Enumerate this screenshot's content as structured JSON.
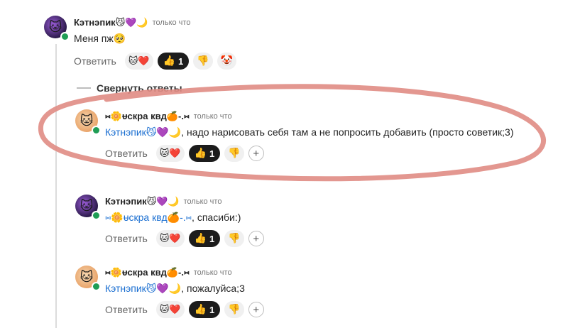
{
  "comments": [
    {
      "author": "Кэтнэпик😼💜🌙",
      "time": "только что",
      "text": "Меня пж🥺",
      "reply_label": "Ответить",
      "reactions": {
        "avatar_emoji": "🐱❤️",
        "like_emoji": "👍",
        "like_count": "1",
        "dislike_emoji": "👎",
        "clown_emoji": "🤡"
      }
    },
    {
      "author": "⑅🌼ᵾскра квд🍊-.⑅",
      "time": "только что",
      "mention": "Кэтнэпик😼💜🌙",
      "text": ", надо нарисовать себя там а не попросить добавить (просто советик;3)",
      "reply_label": "Ответить",
      "reactions": {
        "avatar_emoji": "🐱❤️",
        "like_emoji": "👍",
        "like_count": "1",
        "dislike_emoji": "👎",
        "plus": "+"
      }
    },
    {
      "author": "Кэтнэпик😼💜🌙",
      "time": "только что",
      "mention": "⑅🌼ᵾскра квд🍊-.⑅",
      "text": ", спасиби:)",
      "reply_label": "Ответить",
      "reactions": {
        "avatar_emoji": "🐱❤️",
        "like_emoji": "👍",
        "like_count": "1",
        "dislike_emoji": "👎",
        "plus": "+"
      }
    },
    {
      "author": "⑅🌼ᵾскра квд🍊-.⑅",
      "time": "только что",
      "mention": "Кэтнэпик😼💜🌙",
      "text": ", пожалуйса;3",
      "reply_label": "Ответить",
      "reactions": {
        "avatar_emoji": "🐱❤️",
        "like_emoji": "👍",
        "like_count": "1",
        "dislike_emoji": "👎",
        "plus": "+"
      }
    }
  ],
  "collapse_label": "Свернуть ответы",
  "colors": {
    "mention": "#1b6fd1",
    "annotation_circle": "#e08c84",
    "online_dot": "#1f9d55",
    "dark_pill": "#1c1c1c"
  }
}
